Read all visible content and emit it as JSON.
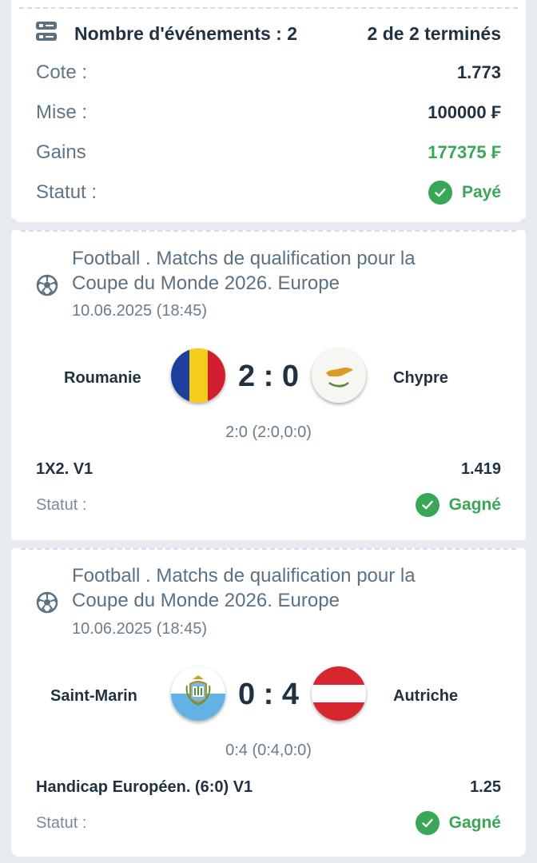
{
  "summary": {
    "events_label": "Nombre d'événements : 2",
    "completed": "2 de 2 terminés",
    "rows": [
      {
        "label": "Cote :",
        "value": "1.773"
      },
      {
        "label": "Mise :",
        "value": "100000 ₣"
      },
      {
        "label": "Gains",
        "value": "177375 ₣"
      },
      {
        "label": "Statut :",
        "value": "Payé"
      }
    ]
  },
  "events": [
    {
      "title_line1": "Football . Matchs de qualification pour la",
      "title_line2": "Coupe du Monde 2026. Europe",
      "date": "10.06.2025 (18:45)",
      "home": "Roumanie",
      "away": "Chypre",
      "score": "2 : 0",
      "detail": "2:0 (2:0,0:0)",
      "bet": "1X2. V1",
      "odds": "1.419",
      "status_label": "Statut :",
      "status": "Gagné"
    },
    {
      "title_line1": "Football . Matchs de qualification pour la",
      "title_line2": "Coupe du Monde 2026. Europe",
      "date": "10.06.2025 (18:45)",
      "home": "Saint-Marin",
      "away": "Autriche",
      "score": "0 : 4",
      "detail": "0:4 (0:4,0:0)",
      "bet": "Handicap Européen. (6:0) V1",
      "odds": "1.25",
      "status_label": "Statut :",
      "status": "Gagné"
    }
  ],
  "icons": {
    "events": "events-list-icon",
    "sport": "football-icon",
    "status": "check-circle-icon"
  },
  "colors": {
    "background": "#e7ebf0",
    "card": "#ffffff",
    "text": "#1f3142",
    "muted": "#5f7586",
    "success": "#3aa757"
  }
}
